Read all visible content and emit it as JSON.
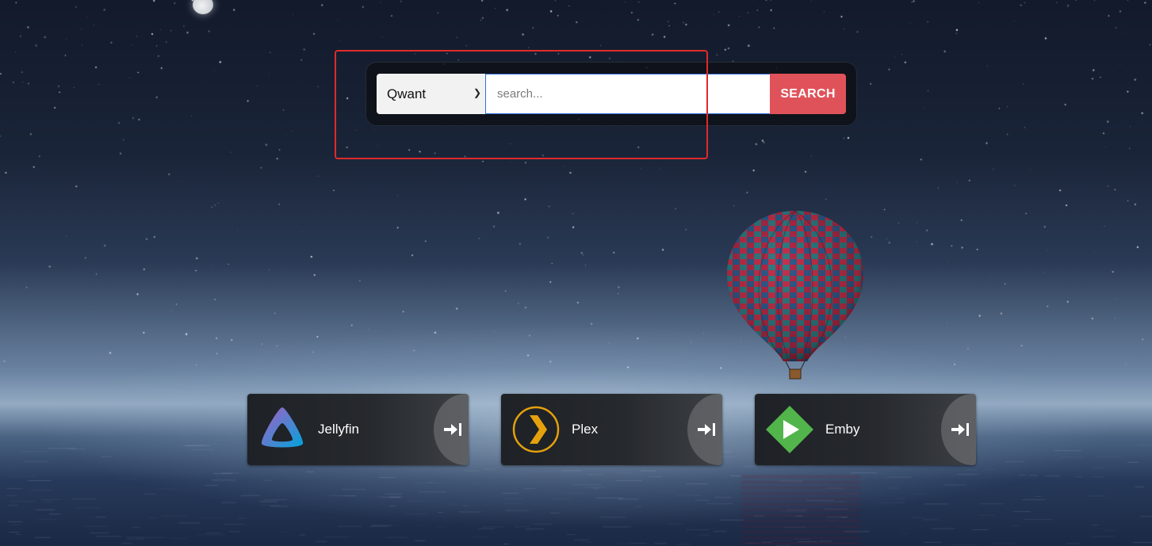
{
  "search": {
    "engine": "Qwant",
    "placeholder": "search...",
    "button_label": "SEARCH"
  },
  "services": [
    {
      "name": "Jellyfin",
      "icon": "jellyfin-icon"
    },
    {
      "name": "Plex",
      "icon": "plex-icon"
    },
    {
      "name": "Emby",
      "icon": "emby-icon"
    }
  ],
  "colors": {
    "search_button": "#e0525a",
    "highlight": "#e02a2a",
    "emby_green": "#52b54b",
    "plex_orange": "#e5a00d"
  }
}
